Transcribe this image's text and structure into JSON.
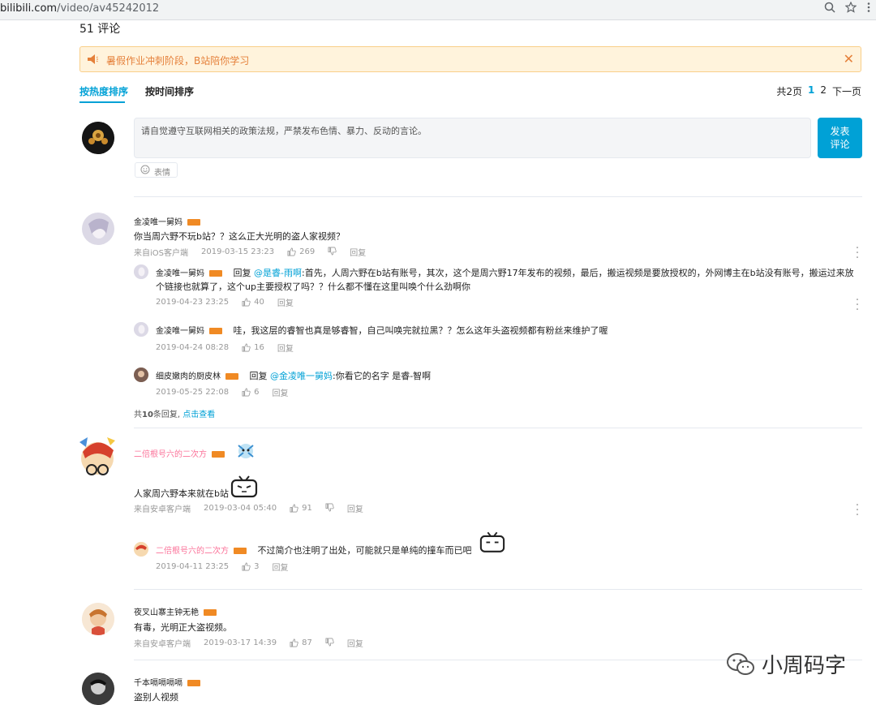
{
  "browser": {
    "domain": "bilibili.com",
    "path": "/video/av45242012"
  },
  "header": {
    "comment_count": "51 评论"
  },
  "notice": {
    "text": "暑假作业冲刺阶段，B站陪你学习",
    "close_glyph": "✕"
  },
  "tabs": [
    {
      "label": "按热度排序",
      "active": true
    },
    {
      "label": "按时间排序",
      "active": false
    }
  ],
  "pager": {
    "total": "共2页",
    "pages": [
      "1",
      "2"
    ],
    "next": "下一页"
  },
  "composer": {
    "placeholder": "请自觉遵守互联网相关的政策法规，严禁发布色情、暴力、反动的言论。",
    "send_line1": "发表",
    "send_line2": "评论",
    "emoji_label": "表情"
  },
  "comments": [
    {
      "user": "金凌唯一舅妈",
      "text": "你当周六野不玩b站？？这么正大光明的盗人家视频？",
      "source": "来自iOS客户端",
      "time": "2019-03-15 23:23",
      "likes": "269",
      "reply_label": "回复",
      "replies": [
        {
          "user": "金凌唯一舅妈",
          "prefix": "回复",
          "mention": "@是睿-雨啊",
          "text_line1": ":首先，人周六野在b站有账号，其次，这个是周六野17年发布的视频，最后，搬运视频是要放授权的，外网博主在b站没有账号，搬运过来放",
          "text_line2": "个链接也就算了，这个up主要授权了吗？？什么都不懂在这里叫唤个什么劲啊你",
          "time": "2019-04-23 23:25",
          "likes": "40",
          "reply_label": "回复"
        },
        {
          "user": "金凌唯一舅妈",
          "text": "哇，我这层的睿智也真是够睿智，自己叫唤完就拉黑？？怎么这年头盗视频都有粉丝来维护了喔",
          "time": "2019-04-24 08:28",
          "likes": "16",
          "reply_label": "回复"
        },
        {
          "user": "细皮嫩肉的厨皮林",
          "prefix": "回复",
          "mention": "@金凌唯一舅妈",
          "text": ":你看它的名字 是睿-智啊",
          "time": "2019-05-25 22:08",
          "likes": "6",
          "reply_label": "回复"
        }
      ],
      "more_prefix": "共",
      "more_count": "10",
      "more_suffix": "条回复,",
      "more_link": "点击查看"
    },
    {
      "user": "二倍根号六的二次方",
      "text": "人家周六野本来就在b站",
      "source": "来自安卓客户端",
      "time": "2019-03-04 05:40",
      "likes": "91",
      "reply_label": "回复",
      "replies": [
        {
          "user": "二倍根号六的二次方",
          "text": "不过简介也注明了出处，可能就只是单纯的撞车而已吧",
          "time": "2019-04-11 23:25",
          "likes": "3",
          "reply_label": "回复"
        }
      ]
    },
    {
      "user": "夜叉山寨主钟无艳",
      "text": "有毒，光明正大盗视频。",
      "source": "来自安卓客户端",
      "time": "2019-03-17 14:39",
      "likes": "87",
      "reply_label": "回复"
    },
    {
      "user": "千本嗝嗝嗝嗝",
      "text": "盗别人视频"
    }
  ],
  "watermark": {
    "text": "小周码字"
  },
  "colors": {
    "accent": "#00a1d6",
    "pink_name": "#fb7299",
    "notice_bg": "#fff3dc",
    "notice_text": "#e5803a",
    "level_badge": "#f08a24"
  }
}
